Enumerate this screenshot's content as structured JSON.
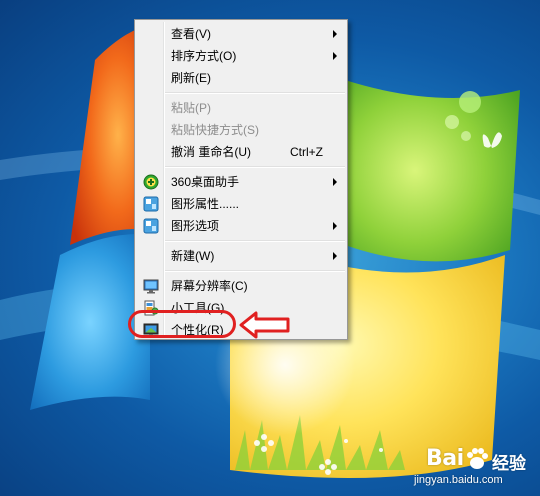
{
  "menu": {
    "items": [
      {
        "label": "查看(V)",
        "submenu": true,
        "enabled": true
      },
      {
        "label": "排序方式(O)",
        "submenu": true,
        "enabled": true
      },
      {
        "label": "刷新(E)",
        "submenu": false,
        "enabled": true
      },
      {
        "label": "粘贴(P)",
        "submenu": false,
        "enabled": false
      },
      {
        "label": "粘贴快捷方式(S)",
        "submenu": false,
        "enabled": false
      },
      {
        "label": "撤消 重命名(U)",
        "shortcut": "Ctrl+Z",
        "submenu": false,
        "enabled": true
      },
      {
        "label": "360桌面助手",
        "icon": "360-assistant-icon",
        "submenu": true,
        "enabled": true
      },
      {
        "label": "图形属性......",
        "icon": "graphics-properties-icon",
        "submenu": false,
        "enabled": true
      },
      {
        "label": "图形选项",
        "icon": "graphics-options-icon",
        "submenu": true,
        "enabled": true
      },
      {
        "label": "新建(W)",
        "submenu": true,
        "enabled": true
      },
      {
        "label": "屏幕分辨率(C)",
        "icon": "screen-resolution-icon",
        "submenu": false,
        "enabled": true
      },
      {
        "label": "小工具(G)",
        "icon": "gadgets-icon",
        "submenu": false,
        "enabled": true
      },
      {
        "label": "个性化(R)",
        "icon": "personalize-icon",
        "submenu": false,
        "enabled": true,
        "highlighted_by_annotation": true
      }
    ]
  },
  "annotation": {
    "color": "#e02020",
    "target": "个性化(R)"
  },
  "watermark": {
    "brand": "Bai",
    "brand_cn": "经验",
    "url": "jingyan.baidu.com"
  },
  "colors": {
    "menu_bg": "#f0f0f0",
    "disabled_text": "#8d8d8d",
    "annotation_red": "#e02020"
  }
}
